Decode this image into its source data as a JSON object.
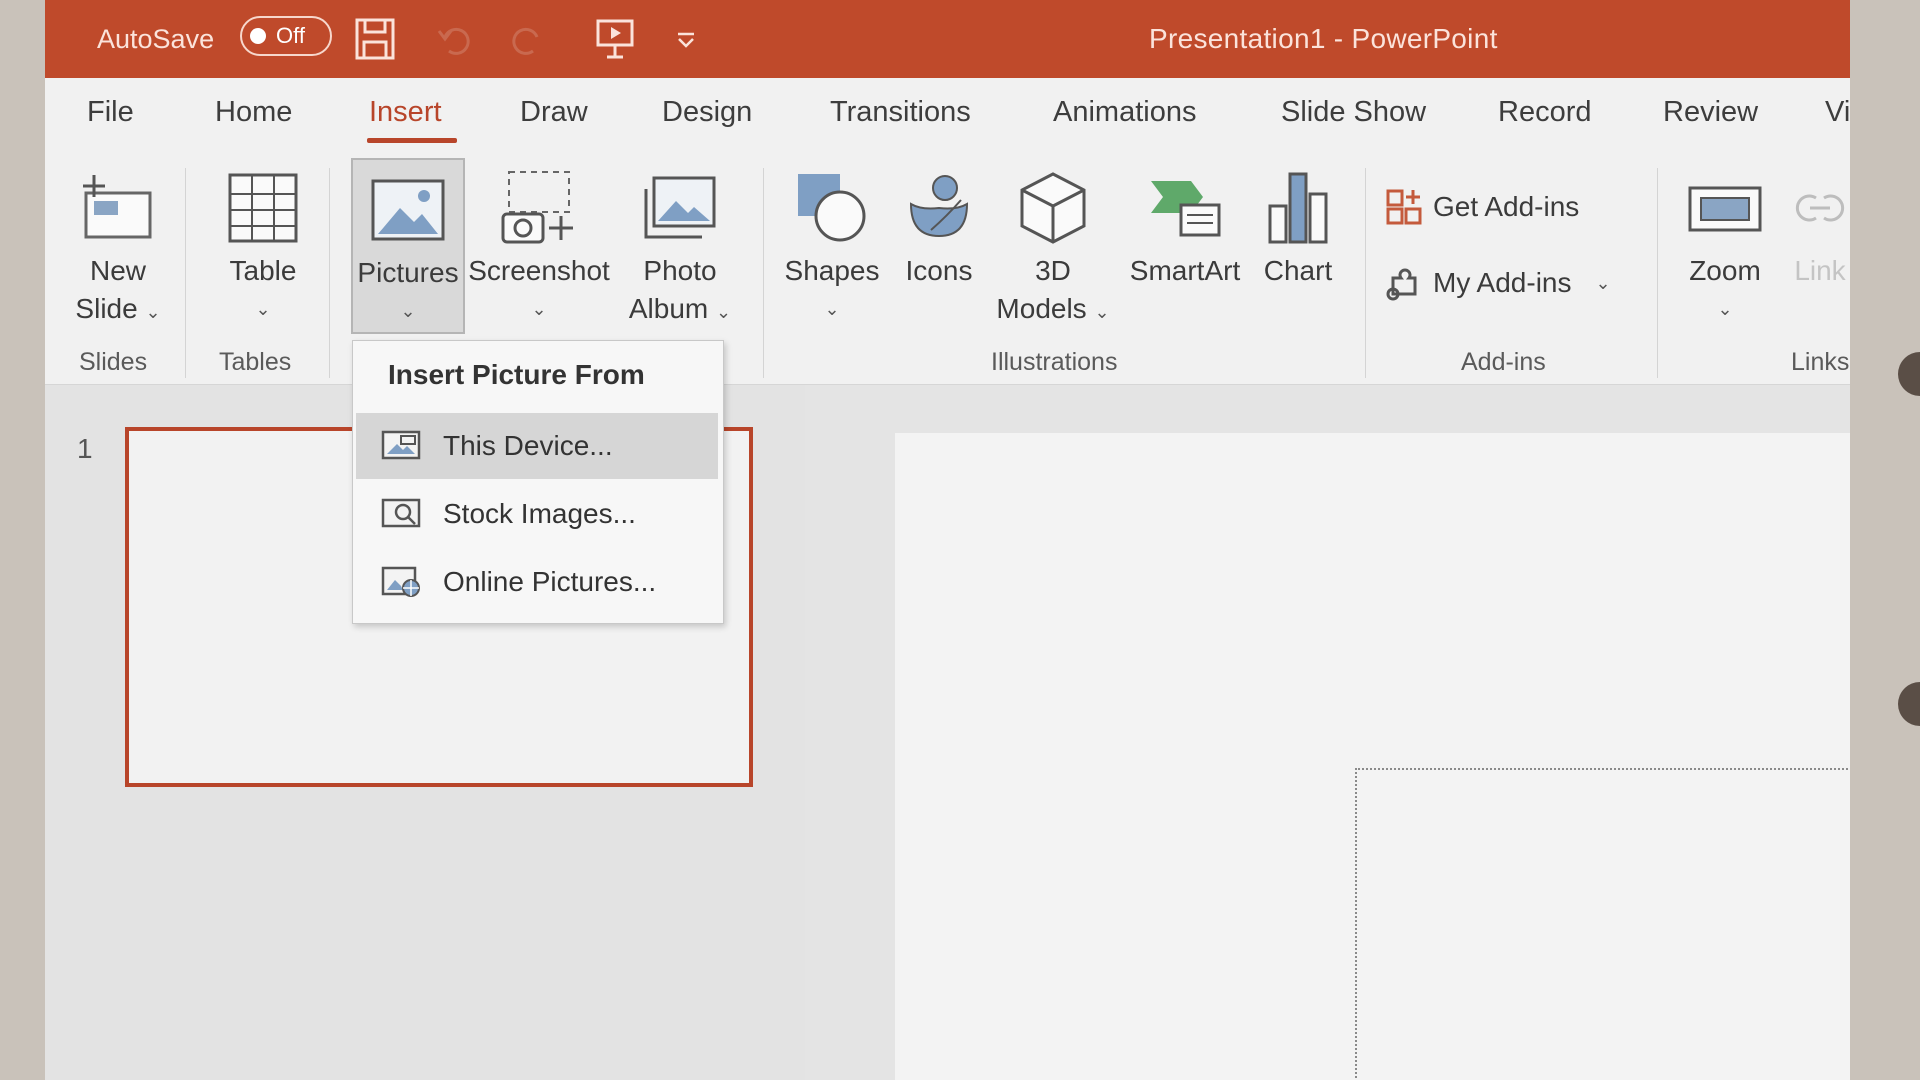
{
  "titlebar": {
    "autosave_label": "AutoSave",
    "autosave_state": "Off",
    "title": "Presentation1  -  PowerPoint"
  },
  "tabs": [
    "File",
    "Home",
    "Insert",
    "Draw",
    "Design",
    "Transitions",
    "Animations",
    "Slide Show",
    "Record",
    "Review",
    "Vi"
  ],
  "active_tab": "Insert",
  "ribbon": {
    "new_slide": [
      "New",
      "Slide"
    ],
    "table": "Table",
    "pictures": "Pictures",
    "screenshot": "Screenshot",
    "photo_album": [
      "Photo",
      "Album"
    ],
    "shapes": "Shapes",
    "icons": "Icons",
    "models_3d": [
      "3D",
      "Models"
    ],
    "smartart": "SmartArt",
    "chart": "Chart",
    "get_addins": "Get Add-ins",
    "my_addins": "My Add-ins",
    "zoom": "Zoom",
    "link": "Link",
    "groups": {
      "slides": "Slides",
      "tables": "Tables",
      "illustrations": "Illustrations",
      "addins": "Add-ins",
      "links": "Links"
    }
  },
  "menu": {
    "header": "Insert Picture From",
    "items": [
      "This Device...",
      "Stock Images...",
      "Online Pictures..."
    ]
  },
  "slides": {
    "number": "1"
  },
  "colors": {
    "accent": "#bf4a2b",
    "tab_active": "#b8452a"
  }
}
